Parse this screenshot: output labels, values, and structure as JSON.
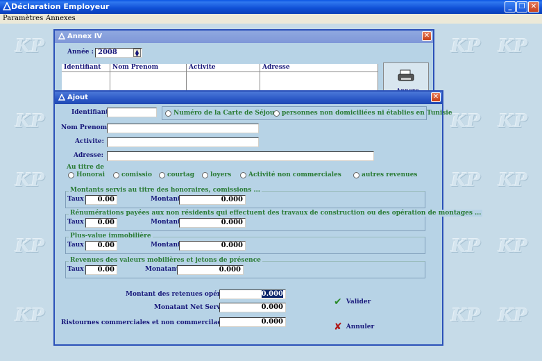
{
  "app": {
    "title": "Déclaration Employeur",
    "menu": [
      "Paramètres",
      "Annexes"
    ]
  },
  "watermark": "KP",
  "annex": {
    "title": "Annex IV",
    "year_label": "Année :",
    "year_value": "2008",
    "columns": [
      "Identifiant",
      "Nom Prenom",
      "Activite",
      "Adresse"
    ],
    "print_button_label": "Annexe"
  },
  "ajout": {
    "title": "Ajout",
    "identifiant_label": "Identifiant:",
    "identifiant_value": "",
    "id_type_options": [
      "Numéro de la Carte de Séjour",
      "personnes non domiciliées ni établies en Tunisie"
    ],
    "nom_label": "Nom Prenom:",
    "activite_label": "Activite:",
    "adresse_label": "Adresse:",
    "au_titre_label": "Au titre de",
    "au_titre_options": [
      "Honorai",
      "comissio",
      "courtag",
      "loyers",
      "Activité non commerciales",
      "autres revenues"
    ],
    "groups": [
      {
        "title": "Montants servis au titre des honoraires, comissions ...",
        "taux_label": "Taux :",
        "taux": "0.00",
        "montant_label": "Montant :",
        "montant": "0.000"
      },
      {
        "title": "Rénumérations payées aux non résidents qui effectuent des travaux de construction ou des opération de montages ...",
        "taux_label": "Taux :",
        "taux": "0.00",
        "montant_label": "Montant :",
        "montant": "0.000"
      },
      {
        "title": "Plus-value immobilière",
        "taux_label": "Taux :",
        "taux": "0.00",
        "montant_label": "Montant :",
        "montant": "0.000"
      },
      {
        "title": "Revenues des valeurs mobilières et jetons de présence",
        "taux_label": "Taux :",
        "taux": "0.00",
        "montant_label": "Monatant :",
        "montant": "0.000"
      }
    ],
    "retenues_label": "Montant des retenues opérées :",
    "retenues_value": "0.000",
    "net_label": "Monatant Net Servi :",
    "net_value": "0.000",
    "ristournes_label": "Ristournes commerciales et non commercilaes servies",
    "ristournes_value": "0.000",
    "valider_label": "Valider",
    "annuler_label": "Annuler"
  }
}
